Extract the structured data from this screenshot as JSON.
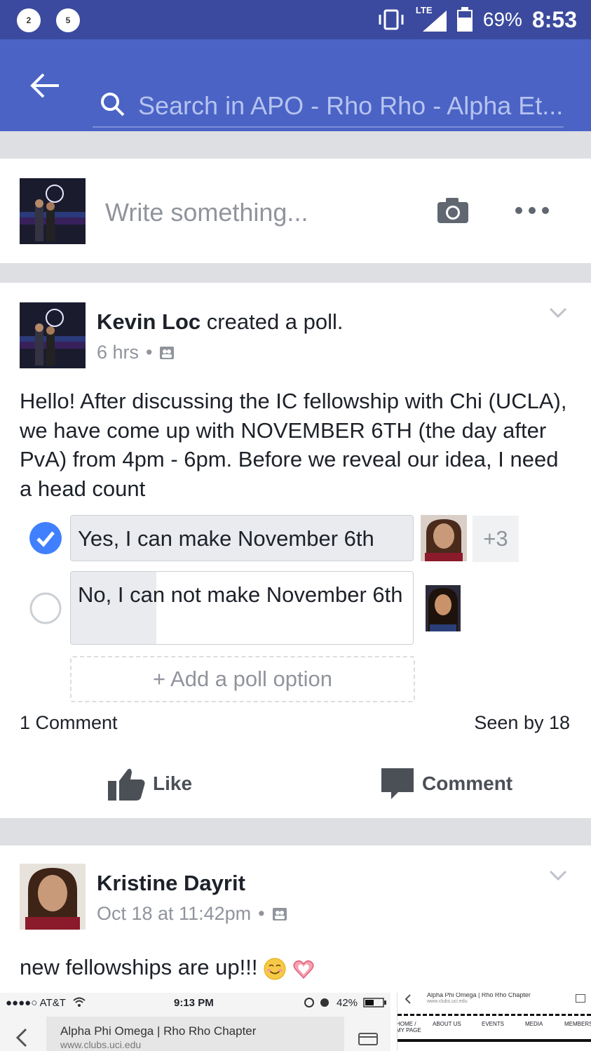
{
  "status_bar": {
    "notifications": [
      "2",
      "5"
    ],
    "network": "LTE",
    "battery": "69%",
    "time": "8:53"
  },
  "search": {
    "placeholder": "Search in APO - Rho Rho - Alpha Et..."
  },
  "composer": {
    "placeholder": "Write something..."
  },
  "post": {
    "author": "Kevin Loc",
    "action": "created a poll.",
    "time": "6 hrs",
    "separator": "•",
    "body": "Hello! After discussing the IC fellowship with Chi (UCLA), we have come up with NOVEMBER 6TH (the day after PvA) from 4pm - 6pm. Before we reveal our idea, I need a head count",
    "poll": {
      "options": [
        {
          "label": "Yes, I can make November 6th",
          "selected": true,
          "vote_fraction": 1.0,
          "extra_voters": "+3"
        },
        {
          "label": "No, I can not make November 6th",
          "selected": false,
          "vote_fraction": 0.25
        }
      ],
      "add_option": "+ Add a poll option"
    },
    "comment_count": "1 Comment",
    "seen_by": "Seen by 18",
    "like_label": "Like",
    "comment_label": "Comment"
  },
  "post2": {
    "author": "Kristine Dayrit",
    "time": "Oct 18 at 11:42pm",
    "separator": "•",
    "body": "new fellowships are up!!!"
  },
  "attachment1": {
    "carrier": "●●●●○ AT&T",
    "time": "9:13 PM",
    "battery": "42%",
    "page_title": "Alpha Phi Omega | Rho Rho Chapter",
    "url": "www.clubs.uci.edu"
  },
  "attachment2": {
    "header": "Alpha Phi Omega | Rho Rho Chapter",
    "url": "www.clubs.uci.edu",
    "nav": [
      "HOME / MY PAGE",
      "ABOUT US",
      "EVENTS",
      "MEDIA",
      "MEMBERS"
    ]
  },
  "colors": {
    "status_bar": "#3b4a9e",
    "header": "#4a63c5",
    "check_blue": "#4080ff"
  }
}
